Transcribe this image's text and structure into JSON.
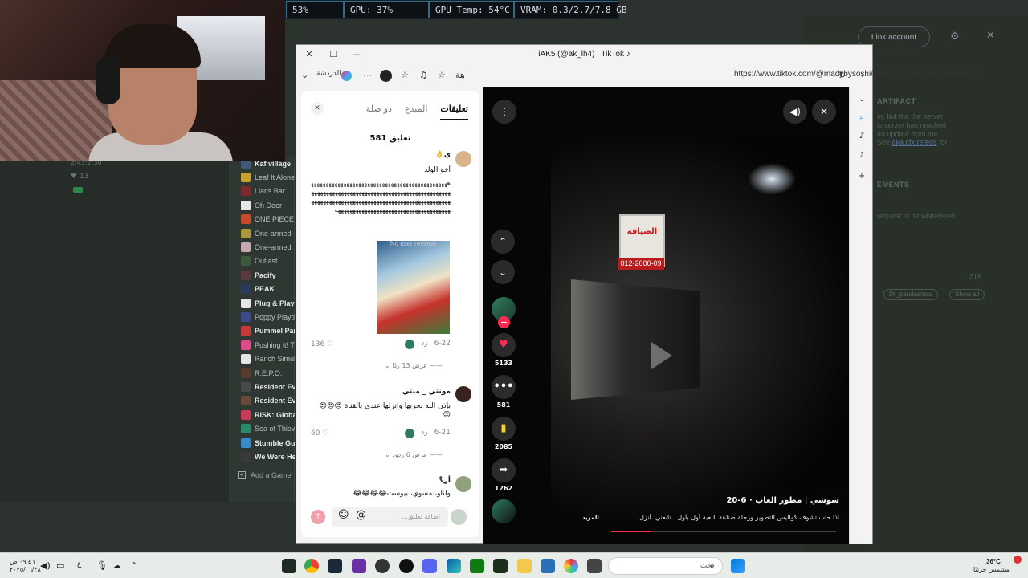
{
  "gpu_overlay": [
    "53%",
    "GPU: 37%",
    "GPU Temp: 54°C",
    "VRAM: 0.3/2.7/7.8 GB"
  ],
  "background_app": {
    "link_button": "Link account",
    "heading_artifact": "ARTIFACT",
    "artifact_lines": [
      "er, but the the server",
      "is server has reached",
      "an update from the"
    ],
    "artifact_link_prefix": "See ",
    "artifact_link": "aka.cfx.re/eos",
    "artifact_link_suffix": " for",
    "heading_elements": "EMENTS",
    "whitelist_text": "request to be whitelisted",
    "number": "218",
    "pills": [
      "Dr_pandasnow",
      "Show all"
    ]
  },
  "left_background": {
    "time": "2:43:2:30",
    "number": "13"
  },
  "library": {
    "items": [
      {
        "label": "Kaf village",
        "bold": true,
        "color": "#3f5a7a"
      },
      {
        "label": "Leaf It Alone",
        "bold": false,
        "color": "#c8a030"
      },
      {
        "label": "Liar's Bar",
        "bold": false,
        "color": "#7a2a2a"
      },
      {
        "label": "Oh Deer",
        "bold": false,
        "color": "#e6e6e6"
      },
      {
        "label": "ONE PIECE B",
        "bold": false,
        "color": "#c84a2a"
      },
      {
        "label": "One-armed",
        "bold": false,
        "color": "#a89a3a"
      },
      {
        "label": "One-armed",
        "bold": false,
        "color": "#c8a8b0"
      },
      {
        "label": "Outlast",
        "bold": false,
        "color": "#3a5a3a"
      },
      {
        "label": "Pacify",
        "bold": true,
        "color": "#5a3a3a"
      },
      {
        "label": "PEAK",
        "bold": true,
        "color": "#2a3a5a"
      },
      {
        "label": "Plug & Play",
        "bold": true,
        "color": "#e6e6e6"
      },
      {
        "label": "Poppy Playti",
        "bold": false,
        "color": "#3a4a8a"
      },
      {
        "label": "Pummel Part",
        "bold": true,
        "color": "#c83a3a"
      },
      {
        "label": "Pushing it! T",
        "bold": false,
        "color": "#e04a8a"
      },
      {
        "label": "Ranch Simul",
        "bold": false,
        "color": "#e6e6e6"
      },
      {
        "label": "R.E.P.O.",
        "bold": false,
        "color": "#5a3a2a"
      },
      {
        "label": "Resident Evi",
        "bold": true,
        "color": "#4a4a4a"
      },
      {
        "label": "Resident Evi",
        "bold": true,
        "color": "#6a4a3a"
      },
      {
        "label": "RISK: Global",
        "bold": true,
        "color": "#c83a5a"
      },
      {
        "label": "Sea of Thiev",
        "bold": false,
        "color": "#2a8a6a"
      },
      {
        "label": "Stumble Guy",
        "bold": true,
        "color": "#3a8aca"
      },
      {
        "label": "We Were He",
        "bold": true,
        "color": "#3a3a3a"
      }
    ],
    "add_game": "Add a Game"
  },
  "browser": {
    "title": "iAK5 (@ak_lh4) | TikTok",
    "url": "https://www.tiktok.com/@madybysoshi/video/7653490500833398024",
    "chat_label": "الدردشة",
    "translate_label": "ﻫﺔ"
  },
  "comments": {
    "tabs": [
      "تعليقات",
      "المبدع",
      "ذو صلة"
    ],
    "count": "581 تعليق",
    "items": [
      {
        "name": "ي👌",
        "text": "أخو الولد",
        "laugh": "هههههههههههههههههههههههههههههههههههههههههههههههههههههههههههههههههههههههههههههههههههههههههههههههههههههههههههههههههههههههههههههههههههههههههههههههههههههههههههههههههههههههههههههههههههه",
        "image_caption": "No user reviews",
        "date": "6-22",
        "reply": "رد",
        "likes": "136",
        "view_replies": "عرض 13 ردًا"
      },
      {
        "name": "مونتي _ منتي",
        "text": "بإذن الله بجربها وانزلها عندي بالقناة 😍😍😍😍",
        "date": "6-21",
        "reply": "رد",
        "likes": "60",
        "view_replies": "عرض 6 ردود"
      },
      {
        "name": "أ📞",
        "text": "ولناو، مسوي، بيوست😂😂😂😂"
      }
    ],
    "input_placeholder": "إضافة تعليق..."
  },
  "video": {
    "sign_text": "الضيافة",
    "sign_number": "012-2000-09",
    "likes": "5133",
    "comments": "581",
    "saves": "2085",
    "shares": "1262",
    "author": "سوشي | مطور العاب · 6-20",
    "description": "اذا حاب تشوف كواليس التطوير ورحلة صناعة اللعبة أول بأول.. تابعني. أنزل",
    "more": "المزيد",
    "progress": 0.18
  },
  "taskbar": {
    "search_placeholder": "بحث",
    "weather_temp": "36°C",
    "weather_desc": "مشمس جزئيًا",
    "time": "٠٩:٤٦ ص",
    "date": "٢٠٢٥/٠٦/٢٨",
    "lang": "ع"
  }
}
